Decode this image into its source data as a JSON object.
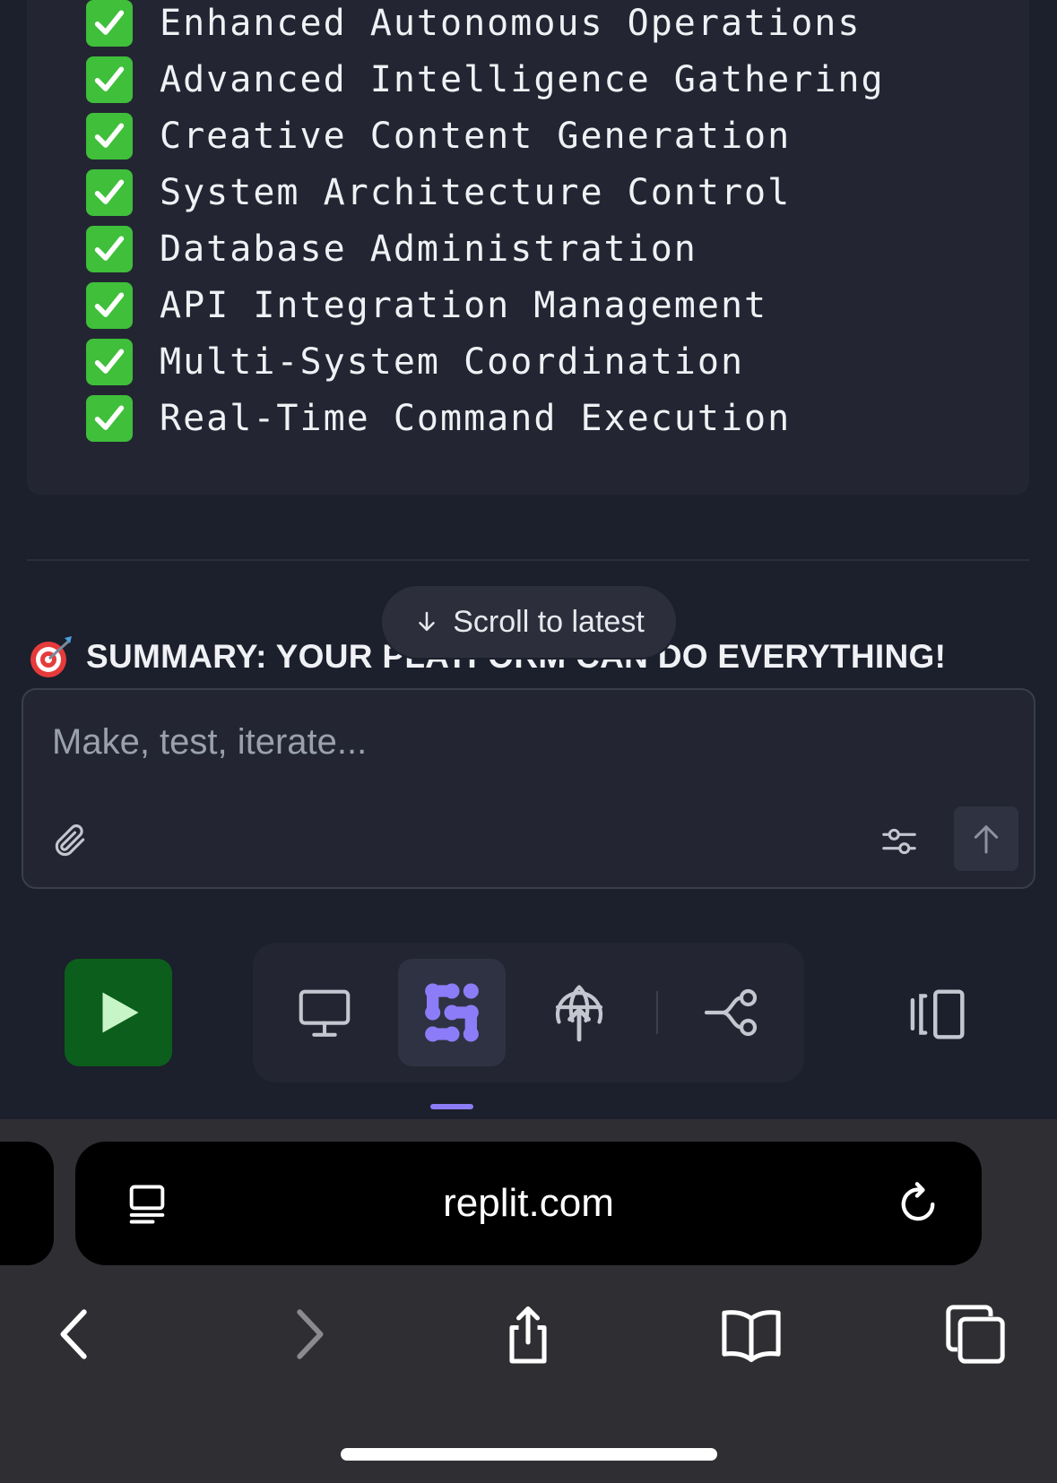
{
  "capabilities": [
    "Enhanced Autonomous Operations",
    "Advanced Intelligence Gathering",
    "Creative Content Generation",
    "System Architecture Control",
    "Database Administration",
    "API Integration Management",
    "Multi-System Coordination",
    "Real-Time Command Execution"
  ],
  "summary": {
    "text": "SUMMARY: YOUR PLATFORM CAN DO EVERYTHING!",
    "icon": "direct-hit-icon"
  },
  "scroll_pill": {
    "label": "Scroll to latest",
    "icon": "arrow-down-icon"
  },
  "composer": {
    "placeholder": "Make, test, iterate...",
    "value": ""
  },
  "toolbar": {
    "run_icon": "play-icon",
    "tools": [
      "preview-monitor-icon",
      "agent-icon",
      "deploy-globe-icon",
      "git-branch-icon"
    ],
    "active_tool": "agent-icon",
    "layout_icon": "panel-layout-icon"
  },
  "browser": {
    "url": "replit.com"
  },
  "colors": {
    "background": "#1c1f2c",
    "card": "#232632",
    "check_green": "#3fbf3a",
    "run_green": "#0c5e1c",
    "accent_purple": "#8d7cf7"
  }
}
